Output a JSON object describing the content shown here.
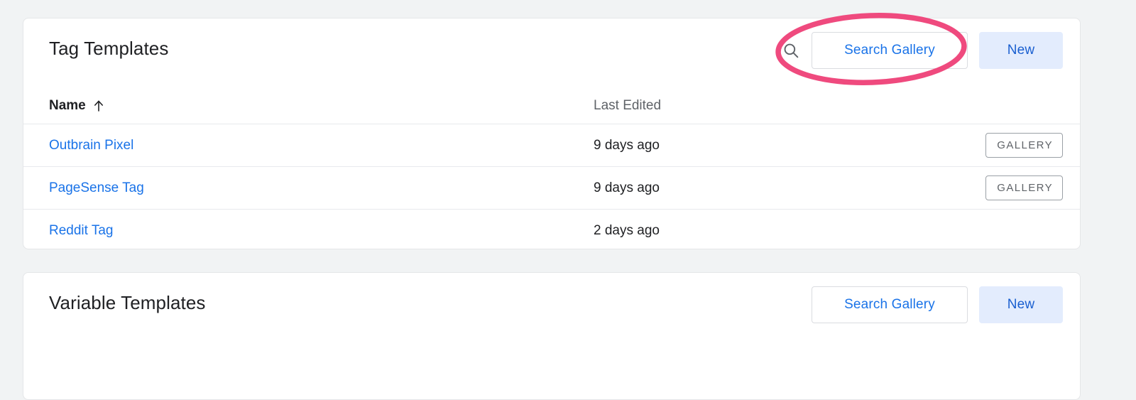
{
  "theme": {
    "page_background": "#f1f3f4",
    "card_background": "#ffffff",
    "link_blue": "#1a73e8",
    "tonal_button_background": "#e3ecfd",
    "annotation_pink": "#ef4a7e",
    "badge_gray": "#5f6368"
  },
  "tag_templates": {
    "title": "Tag Templates",
    "search_icon": "search-icon",
    "search_gallery_label": "Search Gallery",
    "new_label": "New",
    "columns": {
      "name": "Name",
      "sort_icon": "arrow-up-icon",
      "last_edited": "Last Edited"
    },
    "rows": [
      {
        "name": "Outbrain Pixel",
        "last_edited": "9 days ago",
        "badge": "GALLERY"
      },
      {
        "name": "PageSense Tag",
        "last_edited": "9 days ago",
        "badge": "GALLERY"
      },
      {
        "name": "Reddit Tag",
        "last_edited": "2 days ago",
        "badge": ""
      }
    ]
  },
  "variable_templates": {
    "title": "Variable Templates",
    "search_gallery_label": "Search Gallery",
    "new_label": "New"
  },
  "annotation": {
    "shape": "ellipse-highlight",
    "target": "Search Gallery",
    "color": "#ef4a7e"
  }
}
